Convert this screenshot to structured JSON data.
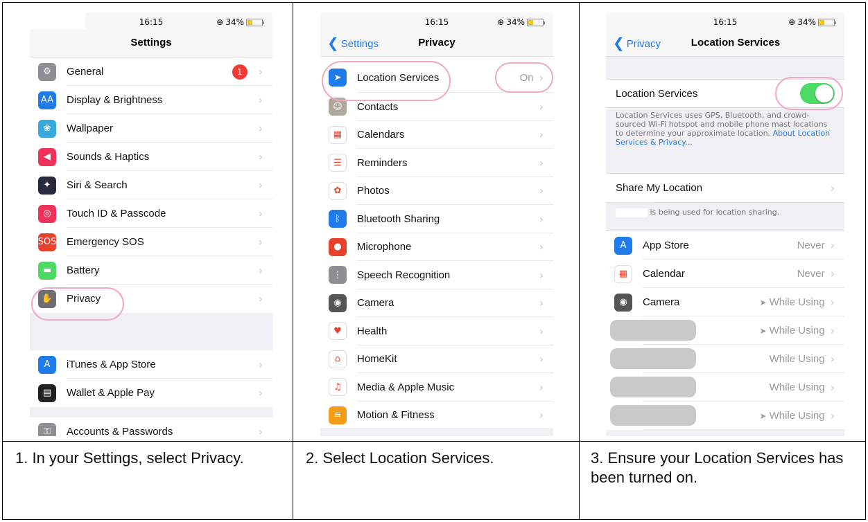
{
  "status": {
    "time": "16:15",
    "battery": "34%"
  },
  "panel1": {
    "title": "Settings",
    "group1": [
      {
        "label": "General",
        "icon": "gear-icon",
        "color": "#8e8e93",
        "glyph": "⚙",
        "badge": "1"
      },
      {
        "label": "Display & Brightness",
        "icon": "display-icon",
        "color": "#1f7aea",
        "glyph": "AA"
      },
      {
        "label": "Wallpaper",
        "icon": "wallpaper-icon",
        "color": "#35aadc",
        "glyph": "❀"
      },
      {
        "label": "Sounds & Haptics",
        "icon": "speaker-icon",
        "color": "#f0325a",
        "glyph": "◀"
      },
      {
        "label": "Siri & Search",
        "icon": "siri-icon",
        "color": "#2b2b40",
        "glyph": "✦"
      },
      {
        "label": "Touch ID & Passcode",
        "icon": "fingerprint-icon",
        "color": "#f0325a",
        "glyph": "◎"
      },
      {
        "label": "Emergency SOS",
        "icon": "sos-icon",
        "color": "#e8412c",
        "glyph": "SOS"
      },
      {
        "label": "Battery",
        "icon": "battery-icon",
        "color": "#4cd964",
        "glyph": "▬"
      },
      {
        "label": "Privacy",
        "icon": "hand-icon",
        "color": "#6d6d72",
        "glyph": "✋"
      }
    ],
    "group2": [
      {
        "label": "iTunes & App Store",
        "icon": "app-store-icon",
        "color": "#1f7aea",
        "glyph": "A"
      },
      {
        "label": "Wallet & Apple Pay",
        "icon": "wallet-icon",
        "color": "#222222",
        "glyph": "▤"
      }
    ],
    "group3": [
      {
        "label": "Accounts & Passwords",
        "icon": "key-icon",
        "color": "#8e8e93",
        "glyph": "⚿"
      }
    ],
    "caption": "1. In your Settings, select Privacy."
  },
  "panel2": {
    "back": "Settings",
    "title": "Privacy",
    "rows": [
      {
        "label": "Location Services",
        "icon": "location-arrow-icon",
        "color": "#1f7aea",
        "glyph": "➤",
        "value": "On"
      },
      {
        "label": "Contacts",
        "icon": "contacts-icon",
        "color": "#b0a89c",
        "glyph": "☺"
      },
      {
        "label": "Calendars",
        "icon": "calendar-icon",
        "color": "#ffffff",
        "glyph": "▦"
      },
      {
        "label": "Reminders",
        "icon": "reminders-icon",
        "color": "#ffffff",
        "glyph": "☰"
      },
      {
        "label": "Photos",
        "icon": "photos-icon",
        "color": "#ffffff",
        "glyph": "✿"
      },
      {
        "label": "Bluetooth Sharing",
        "icon": "bluetooth-icon",
        "color": "#1f7aea",
        "glyph": "ᛒ"
      },
      {
        "label": "Microphone",
        "icon": "microphone-icon",
        "color": "#e8412c",
        "glyph": "●"
      },
      {
        "label": "Speech Recognition",
        "icon": "waveform-icon",
        "color": "#8e8e93",
        "glyph": "⋮"
      },
      {
        "label": "Camera",
        "icon": "camera-icon",
        "color": "#555555",
        "glyph": "◉"
      },
      {
        "label": "Health",
        "icon": "heart-icon",
        "color": "#ffffff",
        "glyph": "♥"
      },
      {
        "label": "HomeKit",
        "icon": "home-icon",
        "color": "#ffffff",
        "glyph": "⌂"
      },
      {
        "label": "Media & Apple Music",
        "icon": "music-icon",
        "color": "#ffffff",
        "glyph": "♫"
      },
      {
        "label": "Motion & Fitness",
        "icon": "motion-icon",
        "color": "#f59b1a",
        "glyph": "≡"
      }
    ],
    "caption": "2. Select Location Services."
  },
  "panel3": {
    "back": "Privacy",
    "title": "Location Services",
    "toggle_label": "Location Services",
    "description": "Location Services uses GPS, Bluetooth, and crowd-sourced Wi-Fi hotspot and mobile phone mast locations to determine your approximate location.",
    "description_link": "About Location Services & Privacy...",
    "share_label": "Share My Location",
    "share_note": "is being used for location sharing.",
    "apps": [
      {
        "label": "App Store",
        "icon": "app-store-icon",
        "color": "#1f7aea",
        "glyph": "A",
        "value": "Never",
        "arrow": false
      },
      {
        "label": "Calendar",
        "icon": "calendar-icon",
        "color": "#ffffff",
        "glyph": "▦",
        "value": "Never",
        "arrow": false
      },
      {
        "label": "Camera",
        "icon": "camera-icon",
        "color": "#555555",
        "glyph": "◉",
        "value": "While Using",
        "arrow": true
      },
      {
        "label": "",
        "value": "While Using",
        "arrow": true
      },
      {
        "label": "",
        "value": "While Using",
        "arrow": false
      },
      {
        "label": "",
        "value": "While Using",
        "arrow": false
      },
      {
        "label": "",
        "value": "While Using",
        "arrow": true
      }
    ],
    "caption": "3. Ensure your Location Services has been turned on."
  }
}
